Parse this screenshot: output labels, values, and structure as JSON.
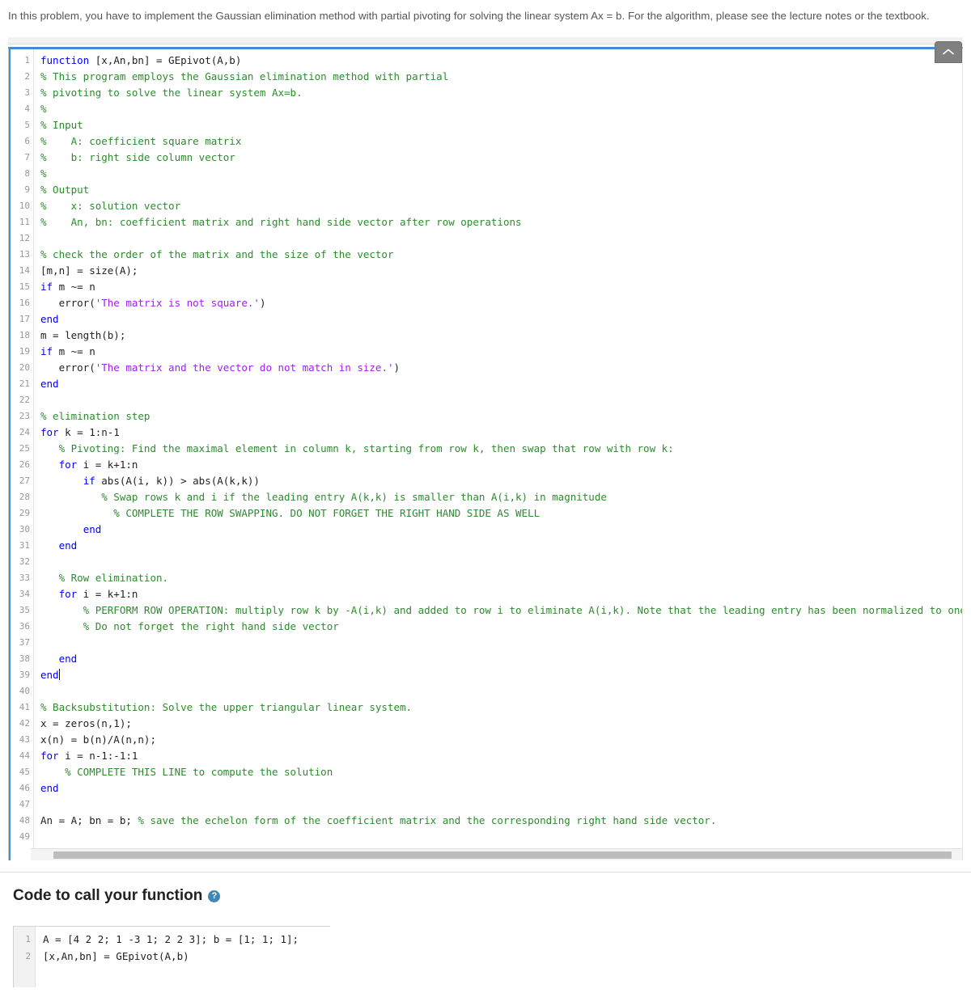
{
  "intro": {
    "text": "In this problem, you have to implement the Gaussian elimination method with partial pivoting for solving the linear system Ax = b. For the algorithm, please see the lecture notes or the textbook."
  },
  "editor": {
    "language": "matlab",
    "top_border_color": "#3a8fd8",
    "line_count": 49,
    "caret_line": 39,
    "scrollbar": {
      "orientation": "horizontal",
      "thumb_color": "#bdbdbd"
    },
    "collapse_button": {
      "icon": "chevron-up-icon",
      "color": "#808080"
    },
    "lines": [
      {
        "n": 1,
        "tokens": [
          {
            "t": "function",
            "c": "kw"
          },
          {
            "t": " [x,An,bn] = GEpivot(A,b)",
            "c": "pl"
          }
        ]
      },
      {
        "n": 2,
        "tokens": [
          {
            "t": "% This program employs the Gaussian elimination method with partial",
            "c": "cm"
          }
        ]
      },
      {
        "n": 3,
        "tokens": [
          {
            "t": "% pivoting to solve the linear system Ax=b.",
            "c": "cm"
          }
        ]
      },
      {
        "n": 4,
        "tokens": [
          {
            "t": "%",
            "c": "cm"
          }
        ]
      },
      {
        "n": 5,
        "tokens": [
          {
            "t": "% Input",
            "c": "cm"
          }
        ]
      },
      {
        "n": 6,
        "tokens": [
          {
            "t": "%    A: coefficient square matrix",
            "c": "cm"
          }
        ]
      },
      {
        "n": 7,
        "tokens": [
          {
            "t": "%    b: right side column vector",
            "c": "cm"
          }
        ]
      },
      {
        "n": 8,
        "tokens": [
          {
            "t": "%",
            "c": "cm"
          }
        ]
      },
      {
        "n": 9,
        "tokens": [
          {
            "t": "% Output",
            "c": "cm"
          }
        ]
      },
      {
        "n": 10,
        "tokens": [
          {
            "t": "%    x: solution vector",
            "c": "cm"
          }
        ]
      },
      {
        "n": 11,
        "tokens": [
          {
            "t": "%    An, bn: coefficient matrix and right hand side vector after row operations",
            "c": "cm"
          }
        ]
      },
      {
        "n": 12,
        "tokens": [
          {
            "t": "",
            "c": "pl"
          }
        ]
      },
      {
        "n": 13,
        "tokens": [
          {
            "t": "% check the order of the matrix and the size of the vector",
            "c": "cm"
          }
        ]
      },
      {
        "n": 14,
        "tokens": [
          {
            "t": "[m,n] = size(A);",
            "c": "pl"
          }
        ]
      },
      {
        "n": 15,
        "tokens": [
          {
            "t": "if",
            "c": "kw"
          },
          {
            "t": " m ~= n",
            "c": "pl"
          }
        ]
      },
      {
        "n": 16,
        "tokens": [
          {
            "t": "   error(",
            "c": "pl"
          },
          {
            "t": "'The matrix is not square.'",
            "c": "str"
          },
          {
            "t": ")",
            "c": "pl"
          }
        ]
      },
      {
        "n": 17,
        "tokens": [
          {
            "t": "end",
            "c": "kw"
          }
        ]
      },
      {
        "n": 18,
        "tokens": [
          {
            "t": "m = length(b);",
            "c": "pl"
          }
        ]
      },
      {
        "n": 19,
        "tokens": [
          {
            "t": "if",
            "c": "kw"
          },
          {
            "t": " m ~= n",
            "c": "pl"
          }
        ]
      },
      {
        "n": 20,
        "tokens": [
          {
            "t": "   error(",
            "c": "pl"
          },
          {
            "t": "'The matrix and the vector do not match in size.'",
            "c": "str"
          },
          {
            "t": ")",
            "c": "pl"
          }
        ]
      },
      {
        "n": 21,
        "tokens": [
          {
            "t": "end",
            "c": "kw"
          }
        ]
      },
      {
        "n": 22,
        "tokens": [
          {
            "t": "",
            "c": "pl"
          }
        ]
      },
      {
        "n": 23,
        "tokens": [
          {
            "t": "% elimination step",
            "c": "cm"
          }
        ]
      },
      {
        "n": 24,
        "tokens": [
          {
            "t": "for",
            "c": "kw"
          },
          {
            "t": " k = 1:n-1",
            "c": "pl"
          }
        ]
      },
      {
        "n": 25,
        "tokens": [
          {
            "t": "   % Pivoting: Find the maximal element in column k, starting from row k, then swap that row with row k:",
            "c": "cm"
          }
        ]
      },
      {
        "n": 26,
        "tokens": [
          {
            "t": "   ",
            "c": "pl"
          },
          {
            "t": "for",
            "c": "kw"
          },
          {
            "t": " i = k+1:n",
            "c": "pl"
          }
        ]
      },
      {
        "n": 27,
        "tokens": [
          {
            "t": "       ",
            "c": "pl"
          },
          {
            "t": "if",
            "c": "kw"
          },
          {
            "t": " abs(A(i, k)) > abs(A(k,k))",
            "c": "pl"
          }
        ]
      },
      {
        "n": 28,
        "tokens": [
          {
            "t": "          % Swap rows k and i if the leading entry A(k,k) is smaller than A(i,k) in magnitude",
            "c": "cm"
          }
        ]
      },
      {
        "n": 29,
        "tokens": [
          {
            "t": "            % COMPLETE THE ROW SWAPPING. DO NOT FORGET THE RIGHT HAND SIDE AS WELL",
            "c": "cm"
          }
        ]
      },
      {
        "n": 30,
        "tokens": [
          {
            "t": "       ",
            "c": "pl"
          },
          {
            "t": "end",
            "c": "kw"
          }
        ]
      },
      {
        "n": 31,
        "tokens": [
          {
            "t": "   ",
            "c": "pl"
          },
          {
            "t": "end",
            "c": "kw"
          }
        ]
      },
      {
        "n": 32,
        "tokens": [
          {
            "t": "",
            "c": "pl"
          }
        ]
      },
      {
        "n": 33,
        "tokens": [
          {
            "t": "   % Row elimination.",
            "c": "cm"
          }
        ]
      },
      {
        "n": 34,
        "tokens": [
          {
            "t": "   ",
            "c": "pl"
          },
          {
            "t": "for",
            "c": "kw"
          },
          {
            "t": " i = k+1:n",
            "c": "pl"
          }
        ]
      },
      {
        "n": 35,
        "tokens": [
          {
            "t": "       % PERFORM ROW OPERATION: multiply row k by -A(i,k) and added to row i to eliminate A(i,k). Note that the leading entry has been normalized to one.",
            "c": "cm"
          }
        ]
      },
      {
        "n": 36,
        "tokens": [
          {
            "t": "       % Do not forget the right hand side vector",
            "c": "cm"
          }
        ]
      },
      {
        "n": 37,
        "tokens": [
          {
            "t": "",
            "c": "pl"
          }
        ]
      },
      {
        "n": 38,
        "tokens": [
          {
            "t": "   ",
            "c": "pl"
          },
          {
            "t": "end",
            "c": "kw"
          }
        ]
      },
      {
        "n": 39,
        "tokens": [
          {
            "t": "end",
            "c": "kw"
          }
        ],
        "caret": true
      },
      {
        "n": 40,
        "tokens": [
          {
            "t": "",
            "c": "pl"
          }
        ]
      },
      {
        "n": 41,
        "tokens": [
          {
            "t": "% Backsubstitution: Solve the upper triangular linear system.",
            "c": "cm"
          }
        ]
      },
      {
        "n": 42,
        "tokens": [
          {
            "t": "x = zeros(n,1);",
            "c": "pl"
          }
        ]
      },
      {
        "n": 43,
        "tokens": [
          {
            "t": "x(n) = b(n)/A(n,n);",
            "c": "pl"
          }
        ]
      },
      {
        "n": 44,
        "tokens": [
          {
            "t": "for",
            "c": "kw"
          },
          {
            "t": " i = n-1:-1:1",
            "c": "pl"
          }
        ]
      },
      {
        "n": 45,
        "tokens": [
          {
            "t": "    % COMPLETE THIS LINE to compute the solution",
            "c": "cm"
          }
        ]
      },
      {
        "n": 46,
        "tokens": [
          {
            "t": "end",
            "c": "kw"
          }
        ]
      },
      {
        "n": 47,
        "tokens": [
          {
            "t": "",
            "c": "pl"
          }
        ]
      },
      {
        "n": 48,
        "tokens": [
          {
            "t": "An = A; bn = b; ",
            "c": "pl"
          },
          {
            "t": "% save the echelon form of the coefficient matrix and the corresponding right hand side vector.",
            "c": "cm"
          }
        ]
      },
      {
        "n": 49,
        "tokens": [
          {
            "t": "",
            "c": "pl"
          }
        ]
      }
    ]
  },
  "call_section": {
    "heading": "Code to call your function",
    "help_icon": "question-mark-icon",
    "lines": [
      {
        "n": 1,
        "text": "A = [4 2 2; 1 -3 1; 2 2 3]; b = [1; 1; 1];"
      },
      {
        "n": 2,
        "text": "[x,An,bn] = GEpivot(A,b)"
      }
    ]
  },
  "colors": {
    "keyword": "#0000ff",
    "comment": "#2e8b2e",
    "string": "#a020f0",
    "accent": "#3a8fd8",
    "help": "#3f88b5"
  }
}
